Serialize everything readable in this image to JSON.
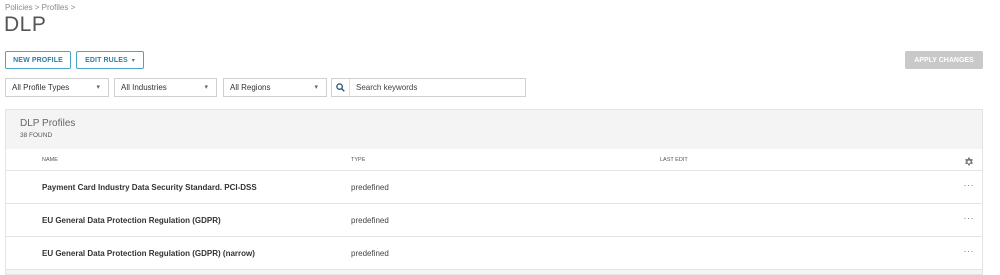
{
  "breadcrumb": "Policies > Profiles >",
  "page_title": "DLP",
  "toolbar": {
    "new_profile": "NEW PROFILE",
    "edit_rules": "EDIT RULES",
    "apply_changes": "APPLY CHANGES"
  },
  "filters": {
    "profile_types": "All Profile Types",
    "industries": "All Industries",
    "regions": "All Regions",
    "search_placeholder": "Search keywords"
  },
  "panel": {
    "title": "DLP Profiles",
    "count": "38 FOUND"
  },
  "table": {
    "columns": [
      "NAME",
      "TYPE",
      "LAST EDIT"
    ],
    "rows": [
      {
        "name": "Payment Card Industry Data Security Standard. PCI-DSS",
        "type": "predefined",
        "last_edit": ""
      },
      {
        "name": "EU General Data Protection Regulation (GDPR)",
        "type": "predefined",
        "last_edit": ""
      },
      {
        "name": "EU General Data Protection Regulation (GDPR) (narrow)",
        "type": "predefined",
        "last_edit": ""
      }
    ],
    "more_label": "···"
  },
  "icons": {
    "search": "search-icon",
    "gear": "gear-icon",
    "chevron": "chevron-down-icon"
  },
  "colors": {
    "accent": "#2b7fa6",
    "button_border": "#4aa3c4",
    "disabled_button": "#c9c9c9",
    "panel_bg": "#f4f4f4"
  }
}
